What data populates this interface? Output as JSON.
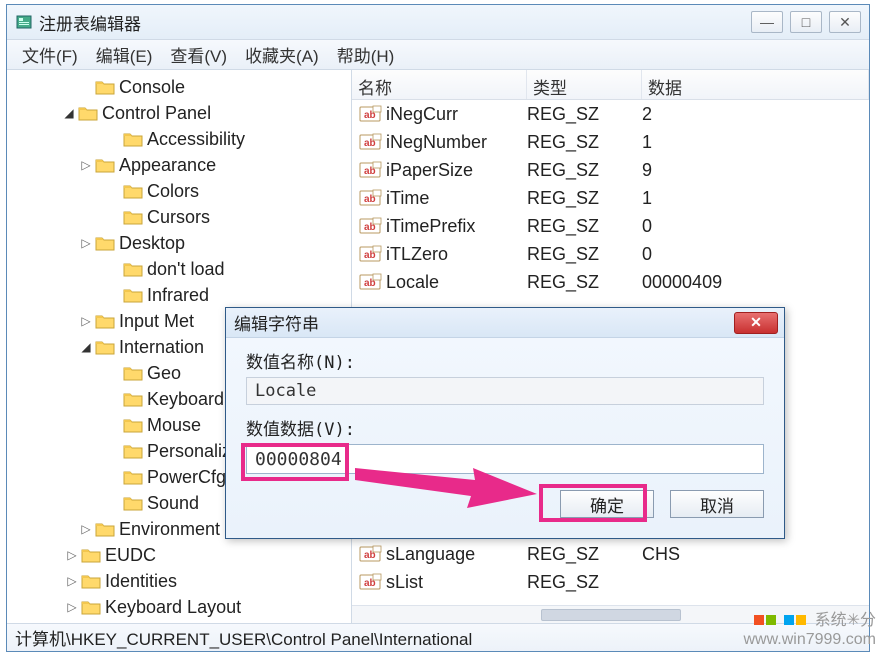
{
  "window": {
    "title": "注册表编辑器",
    "controls": {
      "min": "—",
      "max": "□",
      "close": "✕"
    }
  },
  "menu": {
    "file": "文件(F)",
    "edit": "编辑(E)",
    "view": "查看(V)",
    "favorites": "收藏夹(A)",
    "help": "帮助(H)"
  },
  "tree": {
    "items": [
      {
        "level": "ind1",
        "expand": "",
        "label": "Console"
      },
      {
        "level": "ind0",
        "expand": "▾",
        "label": "Control Panel"
      },
      {
        "level": "ind2",
        "expand": "",
        "label": "Accessibility"
      },
      {
        "level": "ind1",
        "expand": "▸",
        "label": "Appearance"
      },
      {
        "level": "ind2",
        "expand": "",
        "label": "Colors"
      },
      {
        "level": "ind2",
        "expand": "",
        "label": "Cursors"
      },
      {
        "level": "ind1",
        "expand": "▸",
        "label": "Desktop"
      },
      {
        "level": "ind2",
        "expand": "",
        "label": "don't load"
      },
      {
        "level": "ind2",
        "expand": "",
        "label": "Infrared"
      },
      {
        "level": "ind1",
        "expand": "▸",
        "label": "Input Met"
      },
      {
        "level": "ind1",
        "expand": "▾",
        "label": "Internation"
      },
      {
        "level": "ind2",
        "expand": "",
        "label": "Geo"
      },
      {
        "level": "ind2",
        "expand": "",
        "label": "Keyboard"
      },
      {
        "level": "ind2",
        "expand": "",
        "label": "Mouse"
      },
      {
        "level": "ind2",
        "expand": "",
        "label": "Personaliz"
      },
      {
        "level": "ind2",
        "expand": "",
        "label": "PowerCfg"
      },
      {
        "level": "ind2",
        "expand": "",
        "label": "Sound"
      },
      {
        "level": "ind1",
        "expand": "▸",
        "label": "Environment"
      },
      {
        "level": "ind-top",
        "expand": "▸",
        "label": "EUDC"
      },
      {
        "level": "ind-top",
        "expand": "▸",
        "label": "Identities"
      },
      {
        "level": "ind-top",
        "expand": "▸",
        "label": "Keyboard Layout"
      }
    ]
  },
  "list": {
    "headers": {
      "name": "名称",
      "type": "类型",
      "data": "数据"
    },
    "rows": [
      {
        "name": "iNegCurr",
        "type": "REG_SZ",
        "data": "2"
      },
      {
        "name": "iNegNumber",
        "type": "REG_SZ",
        "data": "1"
      },
      {
        "name": "iPaperSize",
        "type": "REG_SZ",
        "data": "9"
      },
      {
        "name": "iTime",
        "type": "REG_SZ",
        "data": "1"
      },
      {
        "name": "iTimePrefix",
        "type": "REG_SZ",
        "data": "0"
      },
      {
        "name": "iTLZero",
        "type": "REG_SZ",
        "data": "0"
      },
      {
        "name": "Locale",
        "type": "REG_SZ",
        "data": "00000409"
      },
      {
        "name": "sLanguage",
        "type": "REG_SZ",
        "data": "CHS"
      },
      {
        "name": "sList",
        "type": "REG_SZ",
        "data": ""
      }
    ],
    "gap_after": 7
  },
  "statusbar": {
    "path": "计算机\\HKEY_CURRENT_USER\\Control Panel\\International"
  },
  "dialog": {
    "title": "编辑字符串",
    "name_label": "数值名称(N):",
    "name_value": "Locale",
    "data_label": "数值数据(V):",
    "data_value": "00000804",
    "ok": "确定",
    "cancel": "取消"
  },
  "watermark": {
    "brand": "系统✳分",
    "url": "www.win7999.com"
  }
}
